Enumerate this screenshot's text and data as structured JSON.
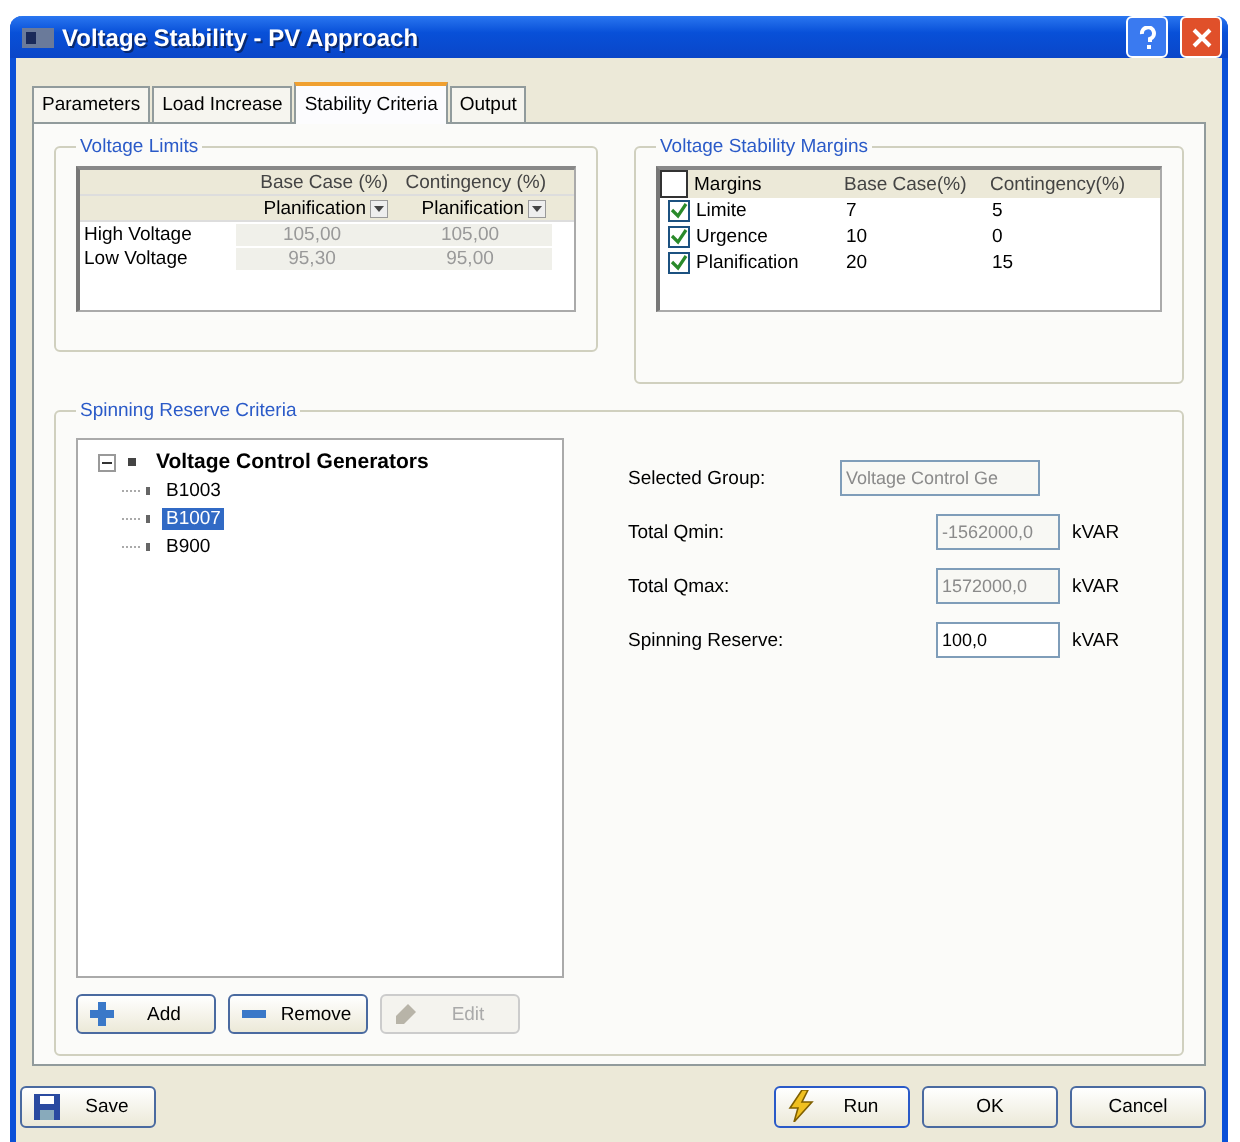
{
  "window": {
    "title": "Voltage Stability - PV Approach"
  },
  "tabs": [
    {
      "label": "Parameters",
      "selected": false
    },
    {
      "label": "Load Increase",
      "selected": false
    },
    {
      "label": "Stability Criteria",
      "selected": true
    },
    {
      "label": "Output",
      "selected": false
    }
  ],
  "voltage_limits": {
    "title": "Voltage Limits",
    "columns": [
      "Base Case (%)",
      "Contingency (%)"
    ],
    "dropdowns": [
      "Planification",
      "Planification"
    ],
    "rows": [
      {
        "label": "High Voltage",
        "values": [
          "105,00",
          "105,00"
        ]
      },
      {
        "label": "Low Voltage",
        "values": [
          "95,30",
          "95,00"
        ]
      }
    ]
  },
  "margins": {
    "title": "Voltage Stability Margins",
    "header_checked": false,
    "columns": [
      "Margins",
      "Base Case(%)",
      "Contingency(%)"
    ],
    "rows": [
      {
        "checked": true,
        "name": "Limite",
        "base": "7",
        "contingency": "5"
      },
      {
        "checked": true,
        "name": "Urgence",
        "base": "10",
        "contingency": "0"
      },
      {
        "checked": true,
        "name": "Planification",
        "base": "20",
        "contingency": "15"
      }
    ]
  },
  "spinning": {
    "title": "Spinning Reserve Criteria",
    "tree": {
      "label": "Voltage Control Generators",
      "expanded": true,
      "children": [
        {
          "label": "B1003",
          "selected": false
        },
        {
          "label": "B1007",
          "selected": true
        },
        {
          "label": "B900",
          "selected": false
        }
      ]
    },
    "fields": [
      {
        "label": "Selected Group:",
        "value": "Voltage Control Ge",
        "disabled": true
      },
      {
        "label": "Total Qmin:",
        "value": "-1562000,0",
        "unit": "kVAR",
        "disabled": true
      },
      {
        "label": "Total Qmax:",
        "value": "1572000,0",
        "unit": "kVAR",
        "disabled": true
      },
      {
        "label": "Spinning Reserve:",
        "value": "100,0",
        "unit": "kVAR",
        "disabled": false
      }
    ],
    "buttons": [
      {
        "kind": "add",
        "label": "Add",
        "disabled": false
      },
      {
        "kind": "remove",
        "label": "Remove",
        "disabled": false
      },
      {
        "kind": "edit",
        "label": "Edit",
        "disabled": true
      }
    ]
  },
  "footer": [
    {
      "kind": "save",
      "label": "Save"
    },
    {
      "kind": "run",
      "label": "Run"
    },
    {
      "kind": "plain",
      "label": "OK"
    },
    {
      "kind": "plain",
      "label": "Cancel"
    }
  ]
}
